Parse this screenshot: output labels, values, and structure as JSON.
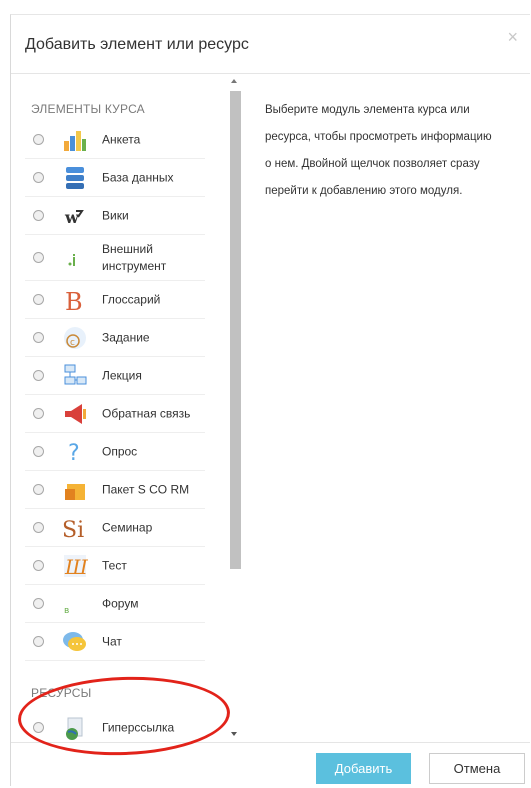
{
  "dialog": {
    "title": "Добавить элемент или ресурс",
    "close_glyph": "×"
  },
  "sections": {
    "activities_header": "ЭЛЕМЕНТЫ КУРСА",
    "resources_header": "РЕСУРСЫ"
  },
  "activities": [
    {
      "label": "Анкета",
      "icon": "bar-chart-icon"
    },
    {
      "label": "База данных",
      "icon": "database-icon"
    },
    {
      "label": "Вики",
      "icon": "wiki-icon"
    },
    {
      "label": "Внешний инструмент",
      "icon": "external-tool-icon"
    },
    {
      "label": "Глоссарий",
      "icon": "glossary-icon"
    },
    {
      "label": "Задание",
      "icon": "assignment-icon"
    },
    {
      "label": "Лекция",
      "icon": "lesson-icon"
    },
    {
      "label": "Обратная связь",
      "icon": "megaphone-icon"
    },
    {
      "label": "Опрос",
      "icon": "question-icon"
    },
    {
      "label": "Пакет S CO RM",
      "icon": "scorm-package-icon"
    },
    {
      "label": "Семинар",
      "icon": "workshop-icon"
    },
    {
      "label": "Тест",
      "icon": "quiz-icon"
    },
    {
      "label": "Форум",
      "icon": "forum-icon"
    },
    {
      "label": "Чат",
      "icon": "chat-icon"
    }
  ],
  "resources": [
    {
      "label": "Гиперссылка",
      "icon": "globe-link-icon"
    }
  ],
  "info_text": "Выберите модуль элемента курса или ресурса, чтобы просмотреть информацию о нем. Двойной щелчок позволяет сразу перейти к добавлению этого модуля.",
  "footer": {
    "add_label": "Добавить",
    "cancel_label": "Отмена"
  },
  "colors": {
    "add_button": "#5bc0de",
    "annotation": "#e2231a"
  }
}
